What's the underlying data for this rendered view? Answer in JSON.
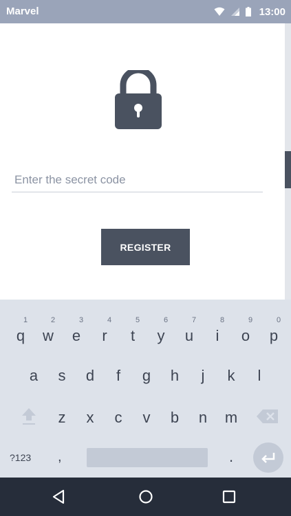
{
  "status_bar": {
    "app_name": "Marvel",
    "time": "13:00",
    "icons": [
      "wifi-icon",
      "signal-icon",
      "battery-icon"
    ]
  },
  "main": {
    "lock_icon": "lock-icon",
    "code_input": {
      "placeholder": "Enter the secret code",
      "value": ""
    },
    "register_label": "REGISTER"
  },
  "keyboard": {
    "row1": [
      {
        "letter": "q",
        "hint": "1"
      },
      {
        "letter": "w",
        "hint": "2"
      },
      {
        "letter": "e",
        "hint": "3"
      },
      {
        "letter": "r",
        "hint": "4"
      },
      {
        "letter": "t",
        "hint": "5"
      },
      {
        "letter": "y",
        "hint": "6"
      },
      {
        "letter": "u",
        "hint": "7"
      },
      {
        "letter": "i",
        "hint": "8"
      },
      {
        "letter": "o",
        "hint": "9"
      },
      {
        "letter": "p",
        "hint": "0"
      }
    ],
    "row2": [
      "a",
      "s",
      "d",
      "f",
      "g",
      "h",
      "j",
      "k",
      "l"
    ],
    "row3": [
      "z",
      "x",
      "c",
      "v",
      "b",
      "n",
      "m"
    ],
    "numbers_label": "?123",
    "comma_label": ",",
    "period_label": ".",
    "shift_icon": "shift-icon",
    "backspace_icon": "backspace-icon",
    "enter_icon": "enter-icon"
  },
  "nav_bar": {
    "icons": [
      "back-icon",
      "home-icon",
      "recents-icon"
    ]
  },
  "colors": {
    "status_bar": "#9aa4b9",
    "accent_dark": "#4a5260",
    "keyboard_bg": "#dde2ea",
    "nav_bar": "#262d3a"
  }
}
